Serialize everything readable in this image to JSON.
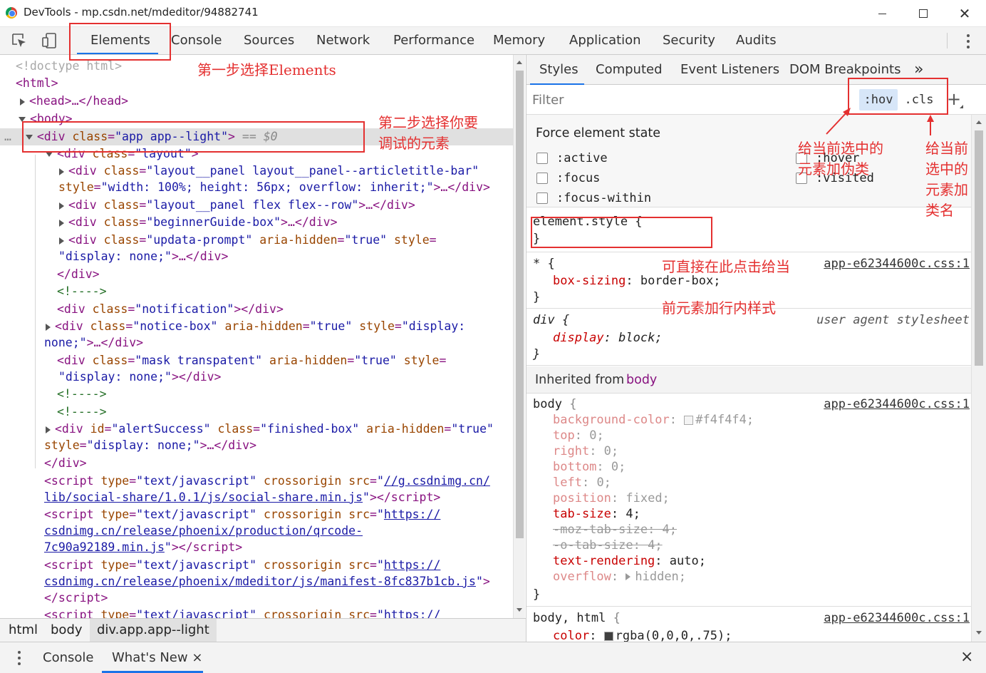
{
  "window": {
    "title": "DevTools - mp.csdn.net/mdeditor/94882741",
    "icon": "chrome-icon"
  },
  "toolbar": {
    "tabs": [
      "Elements",
      "Console",
      "Sources",
      "Network",
      "Performance",
      "Memory",
      "Application",
      "Security",
      "Audits"
    ],
    "selected": "Elements"
  },
  "dom": {
    "doctype": "<!doctype html>",
    "html_open": "<html>",
    "head": "<head>…</head>",
    "body_open": "<body>",
    "selected_marker": "== $0",
    "ellipsis": "…"
  },
  "breadcrumbs": [
    "html",
    "body",
    "div.app.app--light"
  ],
  "styles": {
    "tabs": [
      "Styles",
      "Computed",
      "Event Listeners",
      "DOM Breakpoints"
    ],
    "more": "»",
    "filter_placeholder": "Filter",
    "hov": ":hov",
    "cls": ".cls",
    "plus": "+",
    "force_title": "Force element state",
    "states": [
      ":active",
      ":focus",
      ":focus-within",
      ":hover",
      ":visited"
    ],
    "element_style": "element.style {",
    "close_brace": "}",
    "universal_selector": "* {",
    "universal_source": "app-e62344600c.css:1",
    "box_sizing_prop": "box-sizing",
    "box_sizing_val": "border-box;",
    "div_selector": "div",
    "user_agent": "user agent stylesheet",
    "display_prop": "display",
    "display_val": "block;",
    "inherited_label": "Inherited from",
    "inherited_from": "body",
    "body_selector": "body",
    "body_source": "app-e62344600c.css:1",
    "body_props": [
      {
        "name": "background-color",
        "value": "#f4f4f4;",
        "state": "inactive",
        "swatch": "#f4f4f4"
      },
      {
        "name": "top",
        "value": "0;",
        "state": "inactive"
      },
      {
        "name": "right",
        "value": "0;",
        "state": "inactive"
      },
      {
        "name": "bottom",
        "value": "0;",
        "state": "inactive"
      },
      {
        "name": "left",
        "value": "0;",
        "state": "inactive"
      },
      {
        "name": "position",
        "value": "fixed;",
        "state": "inactive"
      },
      {
        "name": "tab-size",
        "value": "4;",
        "state": "active"
      },
      {
        "name": "-moz-tab-size",
        "value": "4;",
        "state": "strike"
      },
      {
        "name": "-o-tab-size",
        "value": "4;",
        "state": "strike"
      },
      {
        "name": "text-rendering",
        "value": "auto;",
        "state": "active"
      },
      {
        "name": "overflow",
        "value": "hidden;",
        "state": "inactive-expand"
      }
    ],
    "body_html_selector": "body, html",
    "body_html_source": "app-e62344600c.css:1",
    "color_prop": "color",
    "color_val": "rgba(0,0,0,.75);",
    "color_swatch": "#404040"
  },
  "drawer": {
    "tabs": [
      "Console",
      "What's New"
    ],
    "selected": "What's New",
    "close": "×"
  },
  "annotations": {
    "step1": "第一步选择Elements",
    "step2_line1": "第二步选择你要",
    "step2_line2": "调试的元素",
    "hov_line1": "给当前选中的",
    "hov_line2": "元素加伪类",
    "cls_line1": "给当前",
    "cls_line2": "选中的",
    "cls_line3": "元素加",
    "cls_line4": "类名",
    "inline_line1": "可直接在此点击给当",
    "inline_line2": "前元素加行内样式",
    "color": "#e43030"
  }
}
